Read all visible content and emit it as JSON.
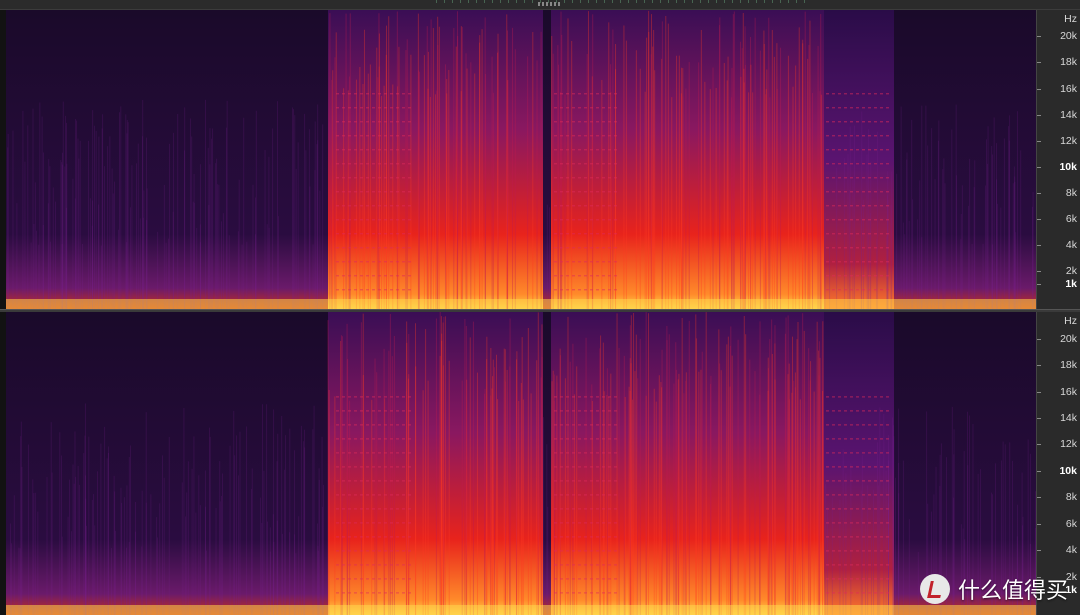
{
  "app": {
    "view": "spectral frequency display"
  },
  "colors": {
    "low": "#1a0a2a",
    "mid": "#7a1a8a",
    "high": "#e8231c",
    "peak": "#ffd34a"
  },
  "channels": [
    {
      "name": "top",
      "axis_unit": "Hz",
      "axis_ticks": [
        {
          "label": "20k",
          "hz": 20000,
          "bold": false
        },
        {
          "label": "18k",
          "hz": 18000,
          "bold": false
        },
        {
          "label": "16k",
          "hz": 16000,
          "bold": false
        },
        {
          "label": "14k",
          "hz": 14000,
          "bold": false
        },
        {
          "label": "12k",
          "hz": 12000,
          "bold": false
        },
        {
          "label": "10k",
          "hz": 10000,
          "bold": true
        },
        {
          "label": "8k",
          "hz": 8000,
          "bold": false
        },
        {
          "label": "6k",
          "hz": 6000,
          "bold": false
        },
        {
          "label": "4k",
          "hz": 4000,
          "bold": false
        },
        {
          "label": "2k",
          "hz": 2000,
          "bold": false
        },
        {
          "label": "1k",
          "hz": 1000,
          "bold": true
        }
      ]
    },
    {
      "name": "bottom",
      "axis_unit": "Hz",
      "axis_ticks": [
        {
          "label": "20k",
          "hz": 20000,
          "bold": false
        },
        {
          "label": "18k",
          "hz": 18000,
          "bold": false
        },
        {
          "label": "16k",
          "hz": 16000,
          "bold": false
        },
        {
          "label": "14k",
          "hz": 14000,
          "bold": false
        },
        {
          "label": "12k",
          "hz": 12000,
          "bold": false
        },
        {
          "label": "10k",
          "hz": 10000,
          "bold": true
        },
        {
          "label": "8k",
          "hz": 8000,
          "bold": false
        },
        {
          "label": "6k",
          "hz": 6000,
          "bold": false
        },
        {
          "label": "4k",
          "hz": 4000,
          "bold": false
        },
        {
          "label": "2k",
          "hz": 2000,
          "bold": false
        },
        {
          "label": "1k",
          "hz": 1000,
          "bold": true
        }
      ]
    }
  ],
  "watermark": {
    "icon": "zhihu-value-logo-icon",
    "text": "什么值得买"
  }
}
